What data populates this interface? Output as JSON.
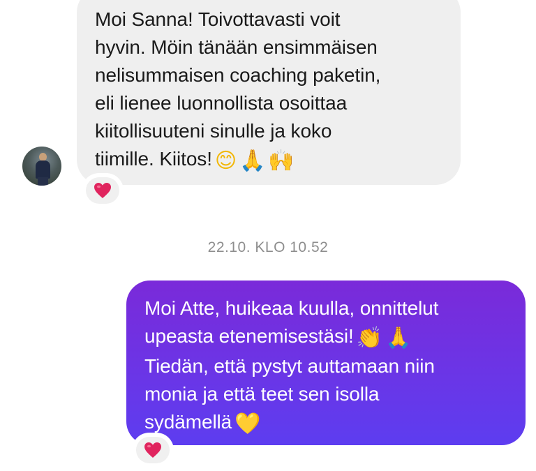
{
  "conversation": {
    "incoming": {
      "lines": [
        "Moi Sanna! Toivottavasti voit",
        "hyvin. Möin tänään ensimmäisen",
        "nelisummaisen coaching paketin,",
        "eli lienee luonnollista osoittaa",
        "kiitollisuuteni sinulle ja koko",
        "tiimille. Kiitos!"
      ],
      "emojis": [
        "😊",
        "🙏",
        "🙌"
      ],
      "reaction": "❤️"
    },
    "timestamp": "22.10. KLO 10.52",
    "outgoing": {
      "lines": [
        "Moi Atte, huikeaa kuulla, onnittelut",
        "upeasta etenemisestäsi!",
        "Tiedän, että pystyt auttamaan niin",
        "monia ja että teet sen isolla",
        "sydämellä"
      ],
      "emojis": [
        "👏",
        "🙏",
        "💛"
      ],
      "reaction": "❤️"
    }
  },
  "colors": {
    "incoming_bubble": "#efefef",
    "outgoing_bubble_top": "#7a2ad9",
    "outgoing_bubble_bottom": "#5d3df0",
    "timestamp_text": "#8e8e8e",
    "heart": "#e0245e"
  },
  "icons": {
    "avatar": "avatar-photo",
    "reaction": "red-heart-icon"
  }
}
